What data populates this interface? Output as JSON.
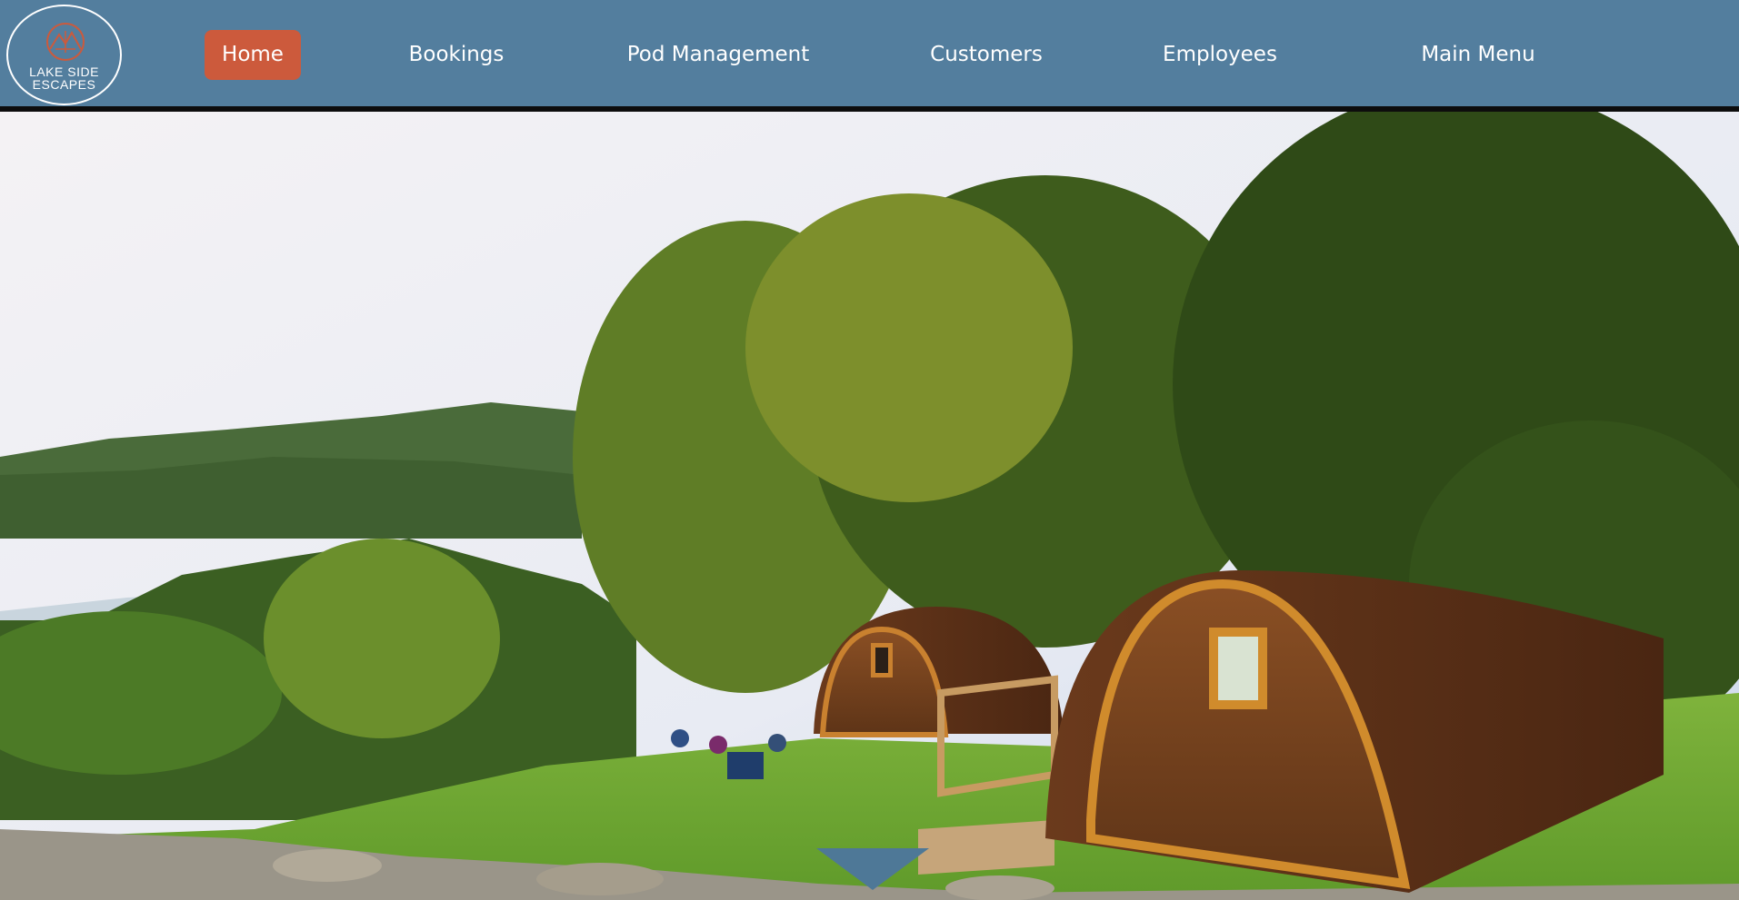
{
  "logo": {
    "line1": "LAKE SIDE",
    "line2": "ESCAPES",
    "icon": "mountain-tent-icon",
    "color": "#cc5a3c"
  },
  "nav": {
    "items": [
      {
        "label": "Home",
        "active": true
      },
      {
        "label": "Bookings",
        "active": false
      },
      {
        "label": "Pod Management",
        "active": false
      },
      {
        "label": "Customers",
        "active": false
      },
      {
        "label": "Employees",
        "active": false
      },
      {
        "label": "Main Menu",
        "active": false
      }
    ]
  },
  "colors": {
    "navbar": "#537e9e",
    "active": "#cc5a3c",
    "arrow": "#4e7897"
  },
  "hero": {
    "alt_icon": "glamping-pods-photo"
  },
  "scroll": {
    "icon": "chevron-down-icon"
  }
}
